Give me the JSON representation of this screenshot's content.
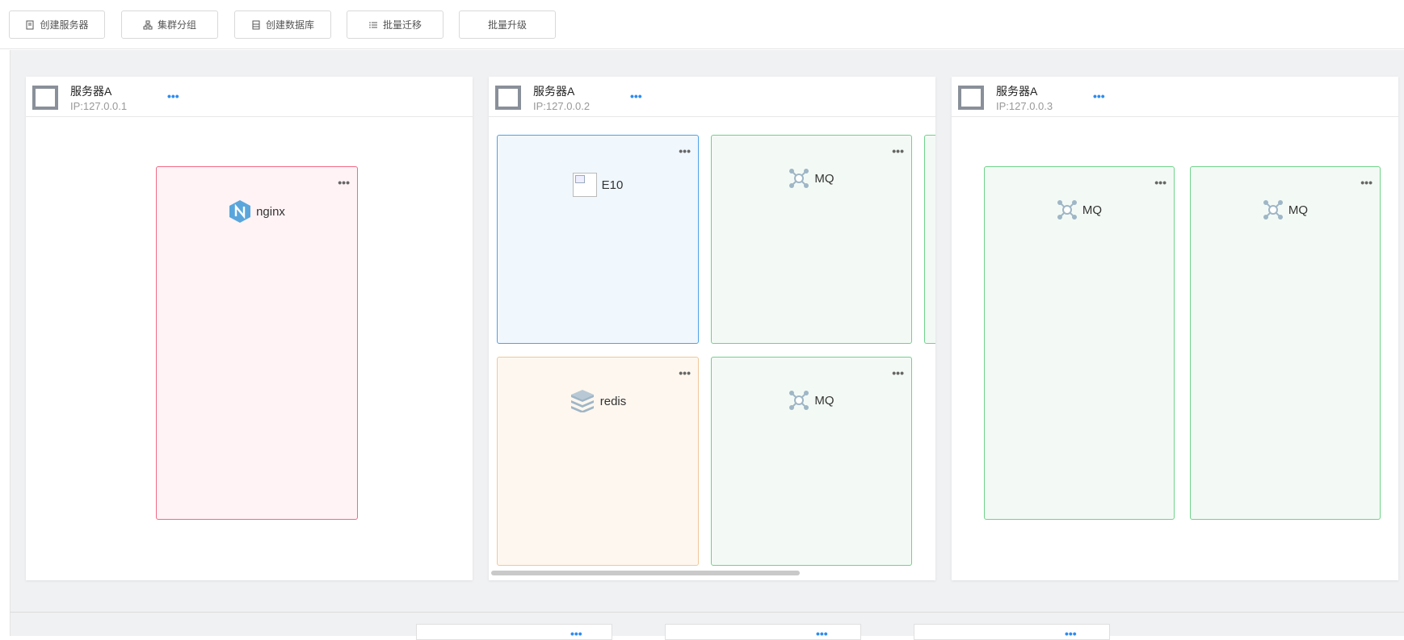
{
  "toolbar": {
    "buttons": [
      {
        "label": "创建服务器",
        "icon": "doc-icon"
      },
      {
        "label": "集群分组",
        "icon": "cluster-icon"
      },
      {
        "label": "创建数据库",
        "icon": "database-icon"
      },
      {
        "label": "批量迁移",
        "icon": "list-icon"
      },
      {
        "label": "批量升级",
        "icon": ""
      }
    ]
  },
  "servers": [
    {
      "name": "服务器A",
      "ip": "IP:127.0.0.1",
      "more": "•••",
      "cards": [
        {
          "label": "nginx",
          "icon": "nginx-icon",
          "more": "•••"
        }
      ]
    },
    {
      "name": "服务器A",
      "ip": "IP:127.0.0.2",
      "more": "•••",
      "cards": [
        {
          "label": "E10",
          "icon": "broken-image-icon",
          "more": "•••"
        },
        {
          "label": "MQ",
          "icon": "mq-icon",
          "more": "•••"
        },
        {
          "label": "redis",
          "icon": "redis-icon",
          "more": "•••"
        },
        {
          "label": "MQ",
          "icon": "mq-icon",
          "more": "•••"
        }
      ]
    },
    {
      "name": "服务器A",
      "ip": "IP:127.0.0.3",
      "more": "•••",
      "cards": [
        {
          "label": "MQ",
          "icon": "mq-icon",
          "more": "•••"
        },
        {
          "label": "MQ",
          "icon": "mq-icon",
          "more": "•••"
        }
      ]
    }
  ],
  "bottom_cards": [
    {
      "more": "•••"
    },
    {
      "more": "•••"
    },
    {
      "more": "•••"
    }
  ],
  "colors": {
    "accent_blue": "#2d8cf0",
    "nginx_card": "#f06a86",
    "e10_card": "#4da3e6",
    "mq_card": "#6fd38a",
    "redis_card": "#f0c89a"
  }
}
